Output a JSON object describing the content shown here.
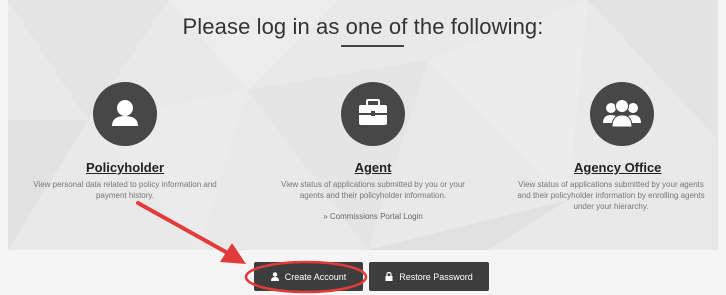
{
  "heading": "Please log in as one of the following:",
  "roles": [
    {
      "title": "Policyholder",
      "icon": "user-icon",
      "description_lines": [
        "View personal data related to policy information and",
        "payment history."
      ]
    },
    {
      "title": "Agent",
      "icon": "briefcase-icon",
      "description_lines": [
        "View status of applications submitted by you or your",
        "agents and their policyholder information."
      ],
      "link": "» Commissions Portal Login"
    },
    {
      "title": "Agency Office",
      "icon": "group-icon",
      "description_lines": [
        "View status of applications submitted by your agents",
        "and their policyholder information by enrolling agents",
        "under your hierarchy."
      ]
    }
  ],
  "buttons": {
    "create_account": "Create Account",
    "restore_password": "Restore Password"
  },
  "colors": {
    "icon_circle": "#474747",
    "button_bg": "#3d3d3d",
    "annotation": "#e23b3b"
  }
}
